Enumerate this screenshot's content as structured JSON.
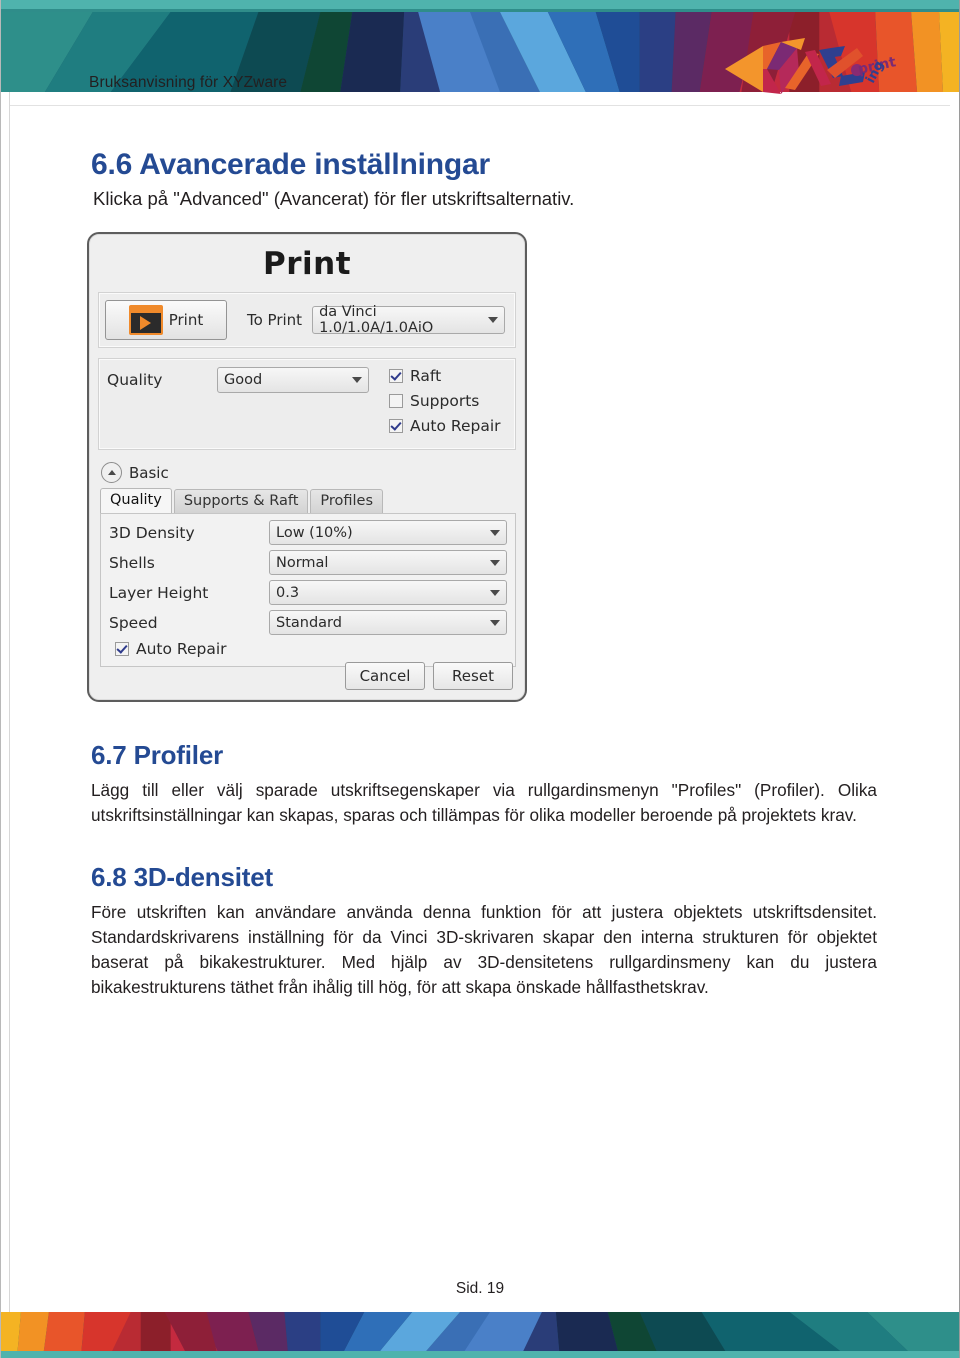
{
  "document": {
    "header_title": "Bruksanvisning för XYZware",
    "logo_alt": "XYZprinting",
    "page_footer": "Sid. 19"
  },
  "colors": {
    "heading_blue": "#244a93",
    "teal_rule": "#4fb3ad",
    "accent_orange": "#f08a2b",
    "body_text": "#231f20"
  },
  "sections": {
    "s66": {
      "heading": "6.6 Avancerade inställningar",
      "paragraph": "Klicka på \"Advanced\" (Avancerat) för fler utskriftsalternativ."
    },
    "s67": {
      "heading": "6.7 Profiler",
      "paragraph": "Lägg till eller välj sparade utskriftsegenskaper via rullgardinsmenyn \"Profiles\" (Profiler). Olika utskriftsinställningar kan skapas, sparas och tillämpas för olika modeller beroende på projektets krav."
    },
    "s68": {
      "heading": "6.8 3D-densitet",
      "paragraph": "Före utskriften kan användare använda denna funktion för att justera objektets utskriftsdensitet. Standardskrivarens inställning för da Vinci 3D-skrivaren skapar den interna strukturen för objektet baserat på bikakestrukturer. Med hjälp av 3D-densitetens rullgardinsmeny kan du justera bikakestrukturens täthet från ihålig till hög, för att skapa önskade hållfasthetskrav."
    }
  },
  "print_dialog": {
    "title": "Print",
    "print_button": "Print",
    "to_print_label": "To Print",
    "printer_value": "da Vinci 1.0/1.0A/1.0AiO",
    "quality_label": "Quality",
    "quality_value": "Good",
    "checkboxes": [
      {
        "label": "Raft",
        "checked": true
      },
      {
        "label": "Supports",
        "checked": false
      },
      {
        "label": "Auto Repair",
        "checked": true
      }
    ],
    "basic_label": "Basic",
    "tabs": [
      {
        "label": "Quality",
        "active": true
      },
      {
        "label": "Supports & Raft",
        "active": false
      },
      {
        "label": "Profiles",
        "active": false
      }
    ],
    "fields": [
      {
        "label": "3D Density",
        "value": "Low (10%)"
      },
      {
        "label": "Shells",
        "value": "Normal"
      },
      {
        "label": "Layer Height",
        "value": "0.3"
      },
      {
        "label": "Speed",
        "value": "Standard"
      }
    ],
    "auto_repair_label": "Auto Repair",
    "auto_repair_checked": true,
    "cancel_button": "Cancel",
    "reset_button": "Reset"
  }
}
